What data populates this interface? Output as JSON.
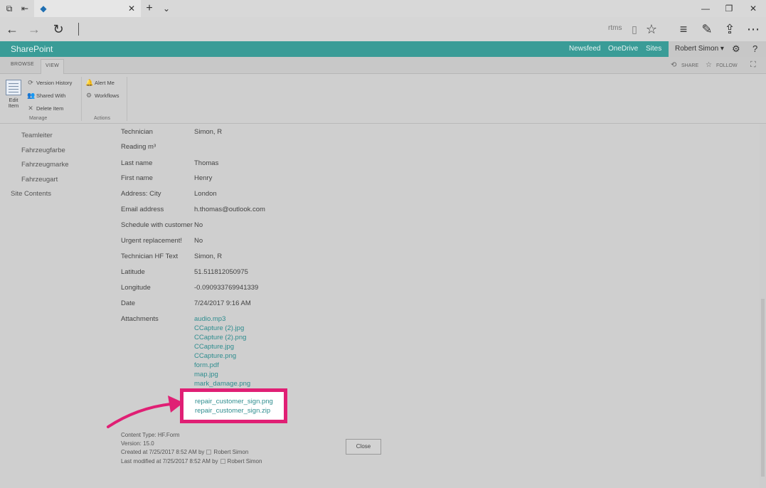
{
  "browser": {
    "address_text": "rtms"
  },
  "suitebar": {
    "brand": "SharePoint",
    "links": [
      "Newsfeed",
      "OneDrive",
      "Sites"
    ],
    "user": "Robert Simon ▾",
    "gear_icon": "gear-icon",
    "help": "?"
  },
  "ribbon": {
    "tabs": [
      "BROWSE",
      "VIEW"
    ],
    "share": "SHARE",
    "follow": "FOLLOW",
    "edit_item": "Edit Item",
    "manage": {
      "buttons": [
        "Version History",
        "Shared With",
        "Delete Item"
      ],
      "label": "Manage"
    },
    "actions": {
      "buttons": [
        "Alert Me",
        "Workflows"
      ],
      "label": "Actions"
    }
  },
  "leftnav": {
    "items": [
      "Teamleiter",
      "Fahrzeugfarbe",
      "Fahrzeugmarke",
      "Fahrzeugart",
      "Site Contents"
    ]
  },
  "form": {
    "fields": [
      {
        "label": "Technician",
        "value": "Simon, R"
      },
      {
        "label": "Reading m³",
        "value": ""
      },
      {
        "label": "Last name",
        "value": "Thomas"
      },
      {
        "label": "First name",
        "value": "Henry"
      },
      {
        "label": "Address: City",
        "value": "London"
      },
      {
        "label": "Email address",
        "value": "h.thomas@outlook.com"
      },
      {
        "label": "Schedule with customer",
        "value": "No"
      },
      {
        "label": "Urgent replacement!",
        "value": "No"
      },
      {
        "label": "Technician HF Text",
        "value": "Simon, R"
      },
      {
        "label": "Latitude",
        "value": "51.511812050975"
      },
      {
        "label": "Longitude",
        "value": "-0.090933769941339"
      },
      {
        "label": "Date",
        "value": "7/24/2017 9:16 AM"
      }
    ],
    "attachments_label": "Attachments",
    "attachments": [
      "audio.mp3",
      "CCapture (2).jpg",
      "CCapture (2).png",
      "CCapture.jpg",
      "CCapture.png",
      "form.pdf",
      "map.jpg",
      "mark_damage.png"
    ],
    "highlighted_attachments": [
      "repair_customer_sign.png",
      "repair_customer_sign.zip"
    ],
    "meta": {
      "content_type": "Content Type: HF.Form",
      "version": "Version: 15.0",
      "created": "Created at 7/25/2017 8:52 AM  by",
      "created_by": "Robert Simon",
      "modified": "Last modified at 7/25/2017 8:52 AM  by",
      "modified_by": "Robert Simon"
    },
    "close_label": "Close"
  },
  "colors": {
    "suitebar": "#3a9c97",
    "link": "#2f8d8f",
    "highlight": "#e01f74"
  }
}
